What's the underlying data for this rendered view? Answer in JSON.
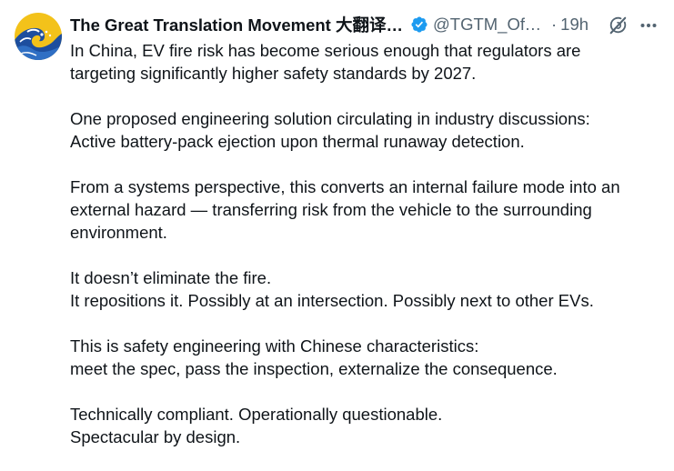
{
  "tweet": {
    "display_name": "The Great Translation Movement 大翻译运动",
    "handle": "@TGTM_Official",
    "separator": "·",
    "time": "19h",
    "avatar_icon": "wave-avatar-icon",
    "verified_icon": "verified-badge-icon",
    "grok_icon": "grok-icon",
    "more_icon": "more-options-icon",
    "colors": {
      "text": "#0f1419",
      "secondary": "#536471",
      "verified": "#1d9bf0"
    },
    "paragraphs": [
      {
        "lines": [
          "In China, EV fire risk has become serious enough that regulators are",
          "targeting significantly higher safety standards by 2027."
        ]
      },
      {
        "lines": [
          "One proposed engineering solution circulating in industry discussions:",
          "Active battery-pack ejection upon thermal runaway detection."
        ]
      },
      {
        "lines": [
          "From a systems perspective, this converts an internal failure mode into an",
          "external hazard — transferring risk from the vehicle to the surrounding",
          "environment."
        ]
      },
      {
        "lines": [
          "It doesn’t eliminate the fire.",
          "It repositions it. Possibly at an intersection. Possibly next to other EVs."
        ]
      },
      {
        "lines": [
          "This is safety engineering with Chinese characteristics:",
          "meet the spec, pass the inspection, externalize the consequence."
        ]
      },
      {
        "lines": [
          "Technically compliant. Operationally questionable.",
          "Spectacular by design."
        ]
      }
    ]
  }
}
